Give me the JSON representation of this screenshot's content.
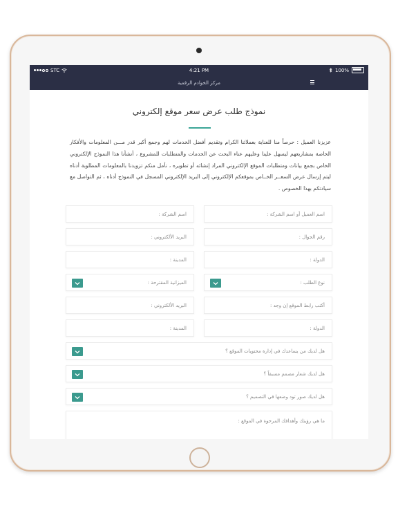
{
  "status_bar": {
    "carrier": "STC",
    "time": "4:21 PM",
    "battery": "100%"
  },
  "nav": {
    "title": "مركز الخوادم الرقمية"
  },
  "page": {
    "title": "نموذج طلب عرض سعر موقع إلكتروني",
    "intro": "عزيزنا العميل : حرصاً منا للعناية بعملائنا الكرام وتقديم أفضل الخدمات لهم وجمع أكبر قدر مـــن المعلومات والأفكار الخاصة بمشاريعهم ليسهل علينا وعليهم عناء البحث عن الخدمات والمتطلبات للمشروع ، أنشأنا هذا النموذج الإلكتروني الخاص بجمع بيانات ومتطلبات الموقع الإلكتروني المراد إنشائه أو تطويره ، نأمل منكم تزويدنا بالمعلومات المطلوبة أدناه ليتم إرسال عرض السعــر الخــاص بموقعكم الإلكتروني إلى البريد الإلكتروني المسجل في النموذج أدناه ، ثم التواصل مع سيادتكم بهذا الخصوص ."
  },
  "form": {
    "client_name": "اسم العميل أو اسم الشركة :",
    "company_name": "اسم الشركة :",
    "mobile": "رقم الجوال :",
    "email1": "البريد الألكتروني :",
    "country1": "الدولة :",
    "city1": "المدينة :",
    "request_type": "نوع الطلب :",
    "budget": "الميزانية المقترحة :",
    "site_url": "أكتب رابط الموقع إن وجد :",
    "email2": "البريد الألكتروني :",
    "country2": "الدولة :",
    "city2": "المدينة :",
    "q_content_manager": "هل لديك من يساعدك في إدارة محتويات الموقع ؟",
    "q_logo": "هل لديك شعار مصمم مسبقاً ؟",
    "q_images": "هل لديك صور تود وضعها في التصميم ؟",
    "q_vision": "ما هي رؤيتك وأهدافك المرجوة في الموقع :"
  },
  "colors": {
    "accent": "#3b9a8e",
    "bar": "#2b2f45"
  }
}
